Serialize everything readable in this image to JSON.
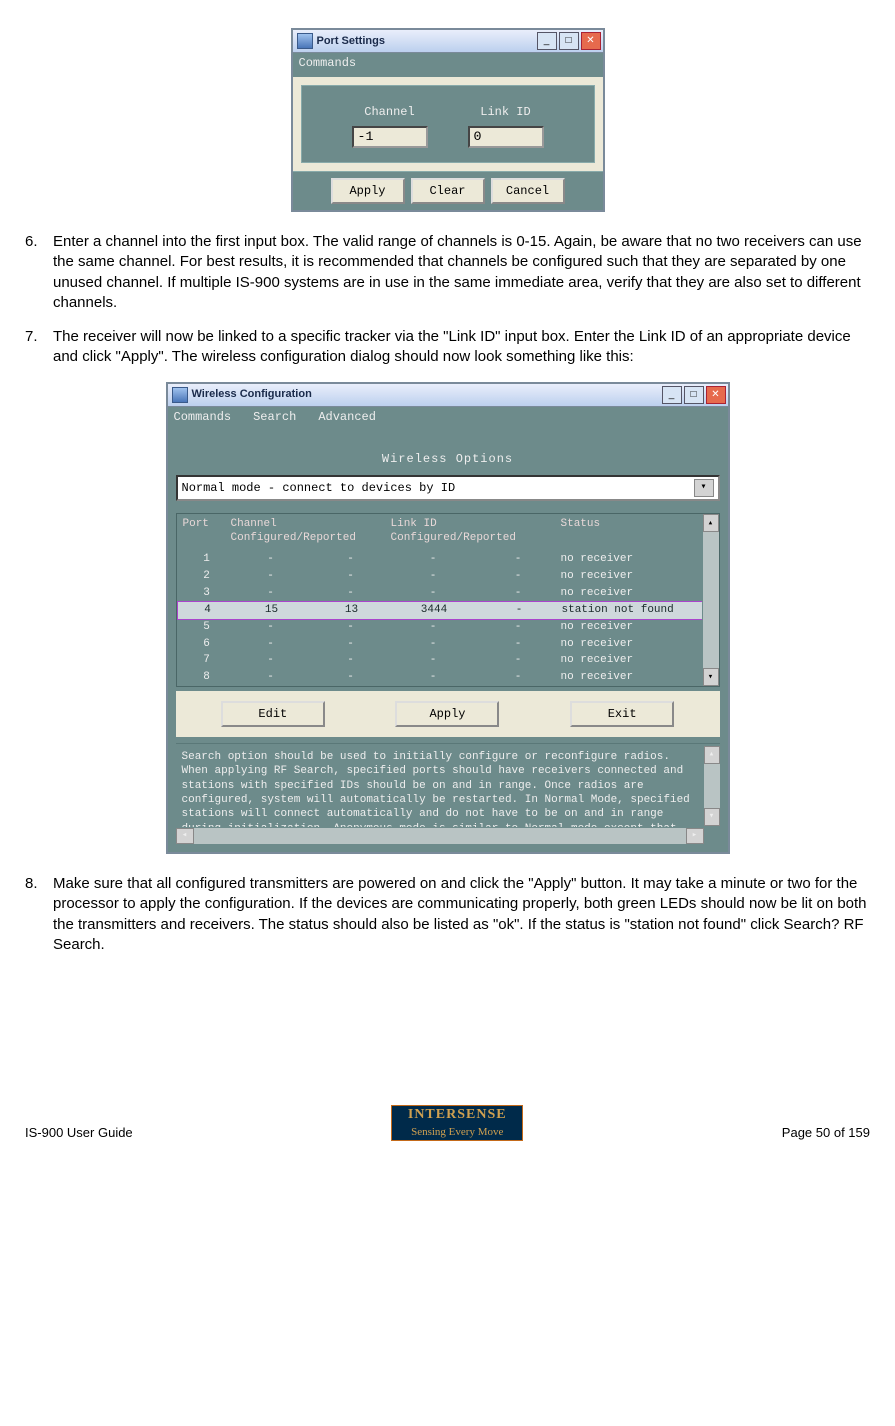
{
  "port_dialog": {
    "title": "Port Settings",
    "menu": "Commands",
    "channel_label": "Channel",
    "linkid_label": "Link ID",
    "channel_value": "-1",
    "linkid_value": "0",
    "apply": "Apply",
    "clear": "Clear",
    "cancel": "Cancel"
  },
  "steps": {
    "n6": "6.",
    "t6": "Enter a channel into the first input box.  The valid range of channels is 0-15.  Again, be aware that no two receivers can use the same channel.  For best results, it is recommended that channels be configured such that they are separated by one unused channel.  If multiple IS-900 systems are in use in the same immediate area, verify that they are also set to different channels.",
    "n7": "7.",
    "t7": "The receiver will now be linked to a specific tracker via the \"Link ID\" input box.  Enter the Link ID of an appropriate device and click \"Apply\".  The wireless configuration dialog should now look something like this:",
    "n8": "8.",
    "t8": "Make sure that all configured transmitters are powered on and click the \"Apply\" button.  It may take a minute or two for the processor to apply the configuration.  If the devices are communicating properly, both green LEDs should now be lit on both the transmitters and receivers.  The status should also be listed as \"ok\".  If the status is \"station not found\" click Search?  RF Search."
  },
  "wl": {
    "title": "Wireless Configuration",
    "menu1": "Commands",
    "menu2": "Search",
    "menu3": "Advanced",
    "section": "Wireless Options",
    "mode": "Normal mode - connect to devices by ID",
    "head_port": "Port",
    "head_chan": "Channel",
    "head_chan2": "Configured/Reported",
    "head_link": "Link ID",
    "head_link2": "Configured/Reported",
    "head_status": "Status",
    "rows": [
      {
        "port": "1",
        "c1": "-",
        "c2": "-",
        "l1": "-",
        "l2": "-",
        "status": "no receiver"
      },
      {
        "port": "2",
        "c1": "-",
        "c2": "-",
        "l1": "-",
        "l2": "-",
        "status": "no receiver"
      },
      {
        "port": "3",
        "c1": "-",
        "c2": "-",
        "l1": "-",
        "l2": "-",
        "status": "no receiver"
      },
      {
        "port": "4",
        "c1": "15",
        "c2": "13",
        "l1": "3444",
        "l2": "-",
        "status": "station not found"
      },
      {
        "port": "5",
        "c1": "-",
        "c2": "-",
        "l1": "-",
        "l2": "-",
        "status": "no receiver"
      },
      {
        "port": "6",
        "c1": "-",
        "c2": "-",
        "l1": "-",
        "l2": "-",
        "status": "no receiver"
      },
      {
        "port": "7",
        "c1": "-",
        "c2": "-",
        "l1": "-",
        "l2": "-",
        "status": "no receiver"
      },
      {
        "port": "8",
        "c1": "-",
        "c2": "-",
        "l1": "-",
        "l2": "-",
        "status": "no receiver"
      }
    ],
    "edit": "Edit",
    "apply": "Apply",
    "exit": "Exit",
    "msg": "Search option should be used to initially configure or reconfigure radios. When applying RF Search, specified ports should have receivers connected and stations with specified IDs should be on and in range. Once radios are configured, system will automatically be restarted. In Normal Mode, specified stations will connect automatically and do not have to be on and in range during initialization. Anonymous mode is similar to Normal mode except that stations are connected"
  },
  "footer": {
    "left": "IS-900 User Guide",
    "right": "Page 50 of 159",
    "logo1": "INTERSENSE",
    "logo2": "Sensing Every Move"
  }
}
